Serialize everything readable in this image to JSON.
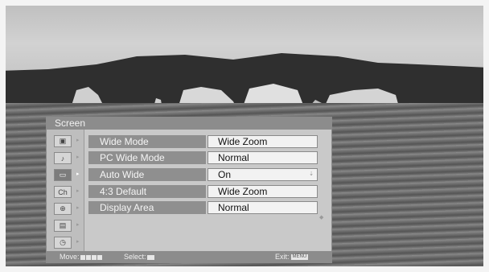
{
  "menu": {
    "title": "Screen",
    "sidebar": [
      {
        "icon": "picture-icon",
        "glyph": "▣"
      },
      {
        "icon": "sound-icon",
        "glyph": "♪"
      },
      {
        "icon": "screen-icon",
        "glyph": "▭"
      },
      {
        "icon": "channel-icon",
        "glyph": "Ch"
      },
      {
        "icon": "parental-lock-icon",
        "glyph": "⊕"
      },
      {
        "icon": "setup-icon",
        "glyph": "▤"
      },
      {
        "icon": "timer-icon",
        "glyph": "◷"
      }
    ],
    "rows": [
      {
        "label": "Wide Mode",
        "value": "Wide Zoom"
      },
      {
        "label": "PC Wide Mode",
        "value": "Normal"
      },
      {
        "label": "Auto Wide",
        "value": "On"
      },
      {
        "label": "4:3 Default",
        "value": "Wide Zoom"
      },
      {
        "label": "Display Area",
        "value": "Normal"
      }
    ]
  },
  "footer": {
    "move_label": "Move:",
    "select_label": "Select:",
    "exit_label": "Exit:",
    "menu_key": "MENU"
  },
  "colors": {
    "header_bg": "#8c8c8c",
    "panel_bg": "#c9c9c9",
    "value_bg": "#f2f2f2"
  }
}
